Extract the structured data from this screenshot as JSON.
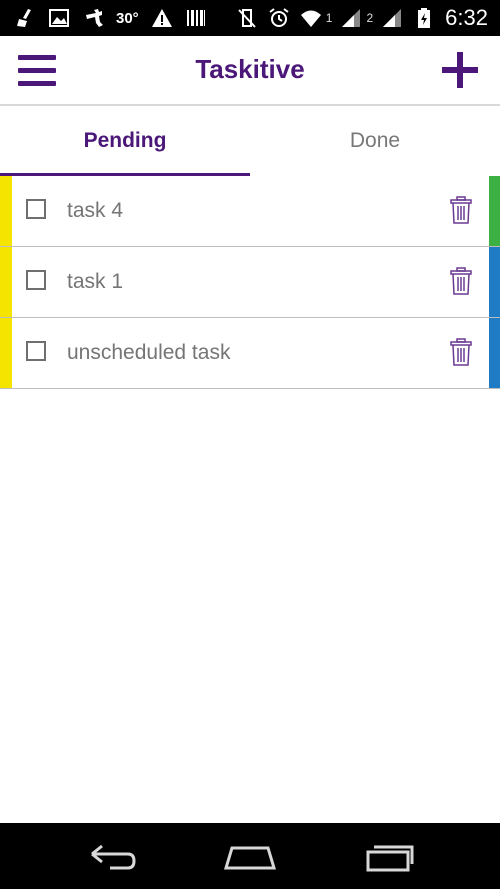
{
  "status_bar": {
    "temperature": "30°",
    "sim1": "1",
    "sim2": "2",
    "time": "6:32",
    "icons": [
      "broom-icon",
      "image-icon",
      "tumblr-icon",
      "warning-icon",
      "barcode-icon",
      "vibrate-off-icon",
      "alarm-icon",
      "wifi-icon",
      "signal-icon",
      "battery-charging-icon"
    ]
  },
  "app_bar": {
    "title": "Taskitive",
    "menu_icon": "hamburger-menu-icon",
    "add_icon": "plus-icon"
  },
  "tabs": [
    {
      "label": "Pending",
      "selected": true
    },
    {
      "label": "Done",
      "selected": false
    }
  ],
  "tasks": [
    {
      "label": "task 4",
      "checked": false,
      "left_color": "#f5e400",
      "right_color": "#3cb043"
    },
    {
      "label": "task 1",
      "checked": false,
      "left_color": "#f5e400",
      "right_color": "#1e7bc4"
    },
    {
      "label": "unscheduled task",
      "checked": false,
      "left_color": "#f5e400",
      "right_color": "#1e7bc4"
    }
  ],
  "nav_bar": {
    "icons": [
      "back-icon",
      "home-icon",
      "recent-apps-icon"
    ]
  },
  "colors": {
    "accent": "#4b1778",
    "text_muted": "#757575"
  }
}
